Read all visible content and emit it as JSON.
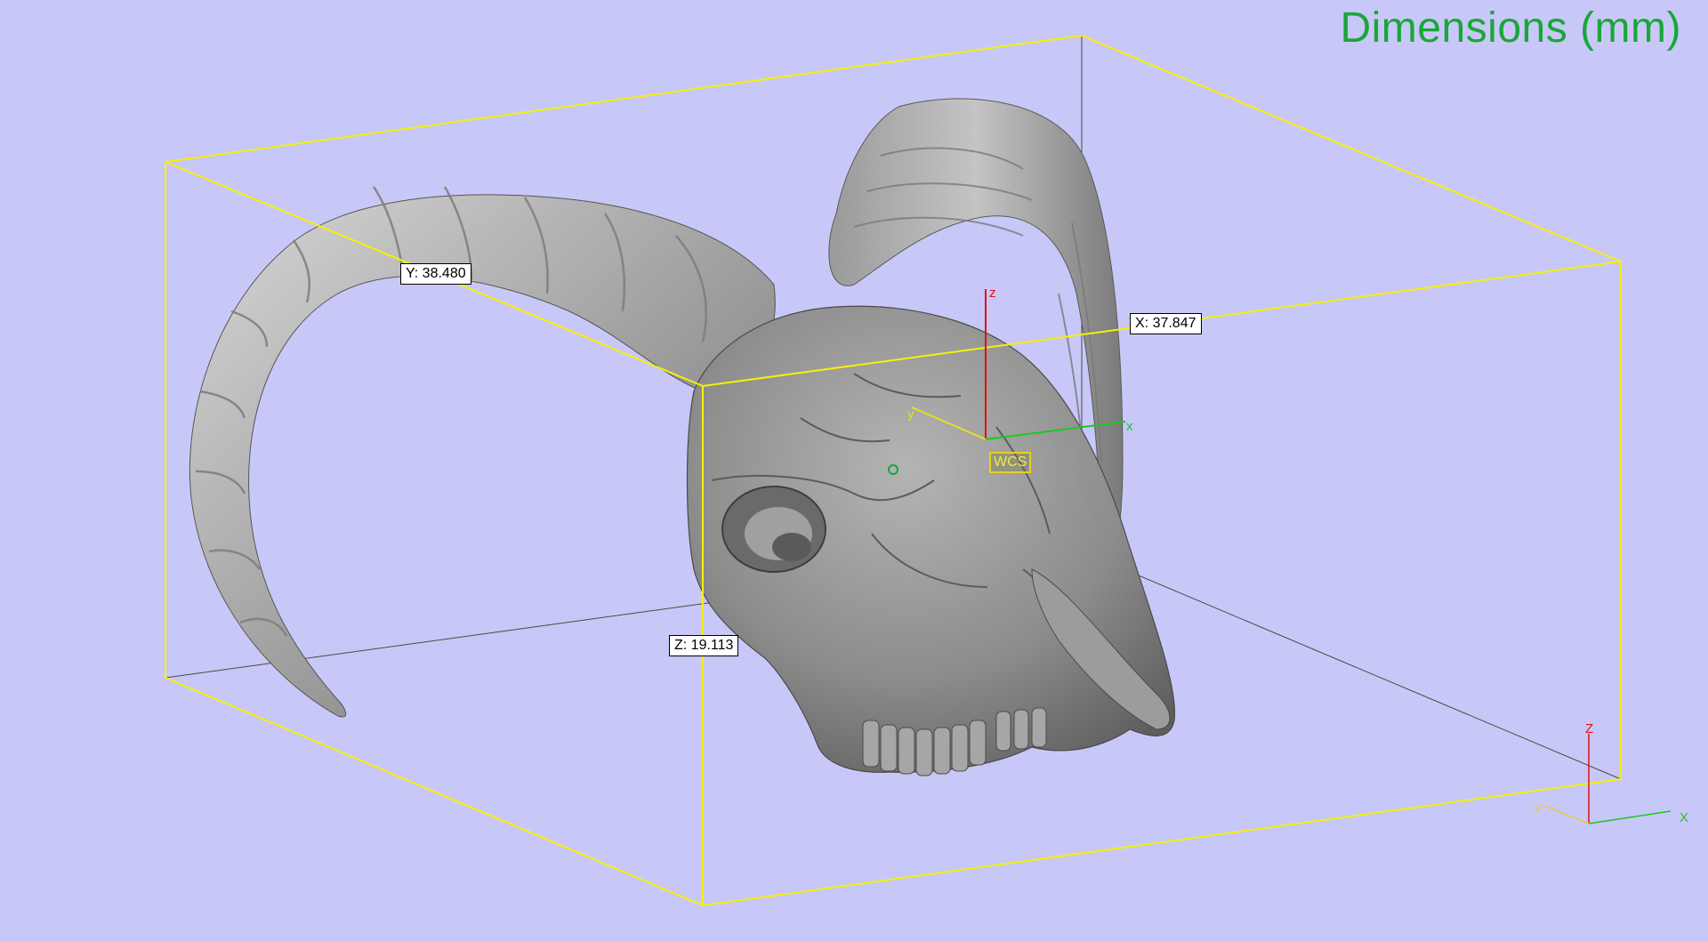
{
  "viewport": {
    "title": "Dimensions (mm)",
    "background": "#c8c8f8",
    "bbox_color": "#f5f00a"
  },
  "dimensions": {
    "x_label": "X: 37.847",
    "y_label": "Y: 38.480",
    "z_label": "Z: 19.113"
  },
  "wcs": {
    "label": "WCS",
    "axis_x": "x",
    "axis_y": "y",
    "axis_z": "z"
  },
  "triad": {
    "axis_x": "X",
    "axis_y": "Y",
    "axis_z": "Z"
  },
  "model": {
    "icon": "ram-skull-mesh-icon"
  }
}
